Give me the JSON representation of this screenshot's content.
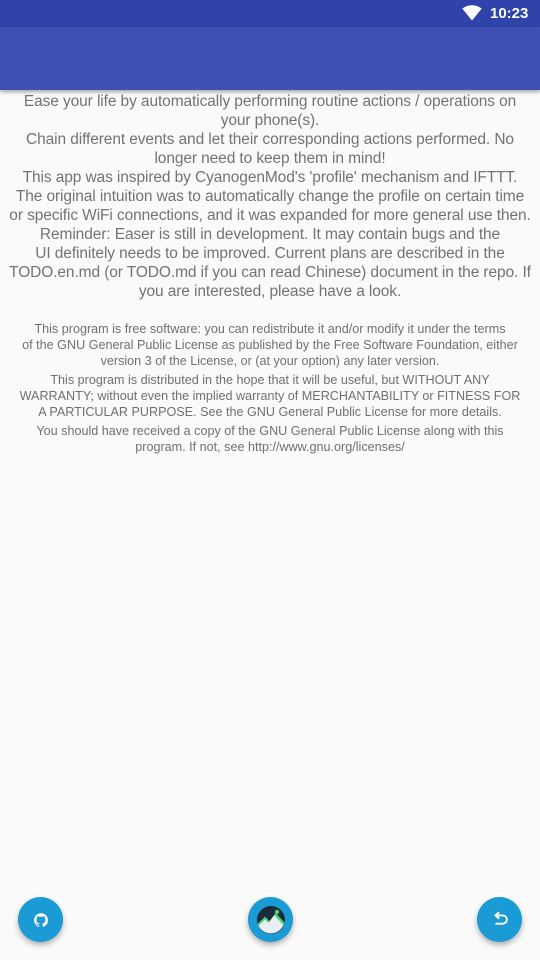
{
  "status_bar": {
    "time": "10:23",
    "wifi_icon": "wifi-icon",
    "background_color": "#3043ab"
  },
  "app_bar": {
    "background_color": "#3f51b5"
  },
  "about": {
    "lines": [
      "Ease your life by automatically performing routine actions / operations on",
      "your phone(s).",
      "Chain different events and let their corresponding actions performed. No",
      "longer need to keep them in mind!",
      "This app was inspired by CyanogenMod's 'profile' mechanism and IFTTT.",
      "The original intuition was to automatically change the profile on certain time",
      "or specific WiFi connections, and it was expanded for more general use then.",
      "Reminder: Easer is still in development. It may contain bugs and the",
      "UI definitely needs to be improved. Current plans are described in the",
      "TODO.en.md (or TODO.md if you can read Chinese) document in the repo. If",
      "you are interested, please have a look."
    ]
  },
  "license": {
    "lines": [
      "This program is free software: you can redistribute it and/or modify it under the terms",
      "of the GNU General Public License as published by the Free Software Foundation, either",
      "version 3 of the License, or (at your option) any later version.",
      "This program is distributed in the hope that it will be useful, but WITHOUT ANY",
      "WARRANTY; without even the implied warranty of MERCHANTABILITY or FITNESS FOR",
      "A PARTICULAR PURPOSE. See the GNU General Public License for more details.",
      "You should have received a copy of the GNU General Public License along with this",
      "program. If not, see http://www.gnu.org/licenses/"
    ]
  },
  "fabs": {
    "github_icon": "github-icon",
    "app_logo_icon": "app-logo-icon",
    "back_icon": "back-arrow-icon",
    "color": "#1a9bd6"
  }
}
